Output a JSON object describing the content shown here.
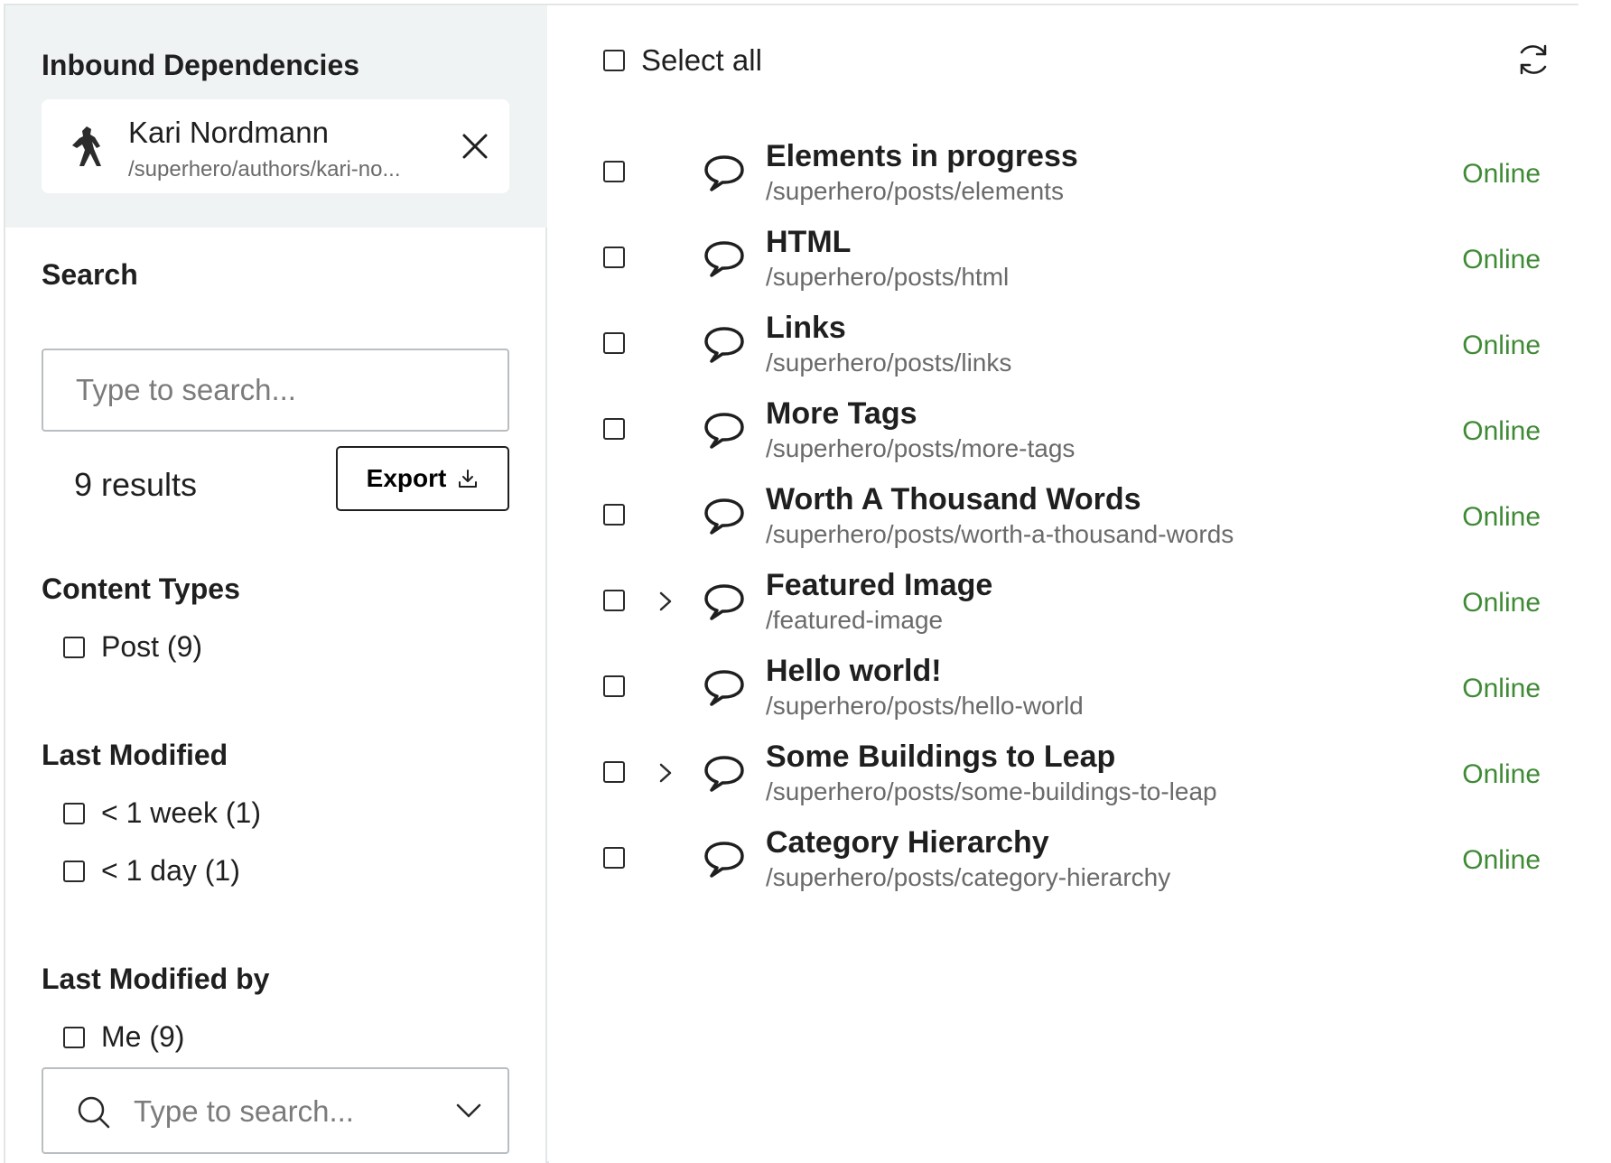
{
  "sidebar": {
    "inbound_title": "Inbound Dependencies",
    "author": {
      "name": "Kari Nordmann",
      "path": "/superhero/authors/kari-no..."
    },
    "search_title": "Search",
    "search_placeholder": "Type to search...",
    "results_text": "9 results",
    "export_label": "Export",
    "content_types_title": "Content Types",
    "content_types": [
      {
        "label": "Post (9)"
      }
    ],
    "last_modified_title": "Last Modified",
    "last_modified": [
      {
        "label": "< 1 week (1)"
      },
      {
        "label": "< 1 day (1)"
      }
    ],
    "last_modified_by_title": "Last Modified by",
    "last_modified_by": [
      {
        "label": "Me (9)"
      }
    ],
    "people_placeholder": "Type to search..."
  },
  "main": {
    "select_all_label": "Select all",
    "items": [
      {
        "title": "Elements in progress",
        "path": "/superhero/posts/elements",
        "status": "Online",
        "expandable": false
      },
      {
        "title": "HTML",
        "path": "/superhero/posts/html",
        "status": "Online",
        "expandable": false
      },
      {
        "title": "Links",
        "path": "/superhero/posts/links",
        "status": "Online",
        "expandable": false
      },
      {
        "title": "More Tags",
        "path": "/superhero/posts/more-tags",
        "status": "Online",
        "expandable": false
      },
      {
        "title": "Worth A Thousand Words",
        "path": "/superhero/posts/worth-a-thousand-words",
        "status": "Online",
        "expandable": false
      },
      {
        "title": "Featured Image",
        "path": "/featured-image",
        "status": "Online",
        "expandable": true
      },
      {
        "title": "Hello world!",
        "path": "/superhero/posts/hello-world",
        "status": "Online",
        "expandable": false
      },
      {
        "title": "Some Buildings to Leap",
        "path": "/superhero/posts/some-buildings-to-leap",
        "status": "Online",
        "expandable": true
      },
      {
        "title": "Category Hierarchy",
        "path": "/superhero/posts/category-hierarchy",
        "status": "Online",
        "expandable": false
      }
    ]
  },
  "colors": {
    "status_online": "#3f8a35",
    "inbound_bg": "#f0f3f4"
  }
}
